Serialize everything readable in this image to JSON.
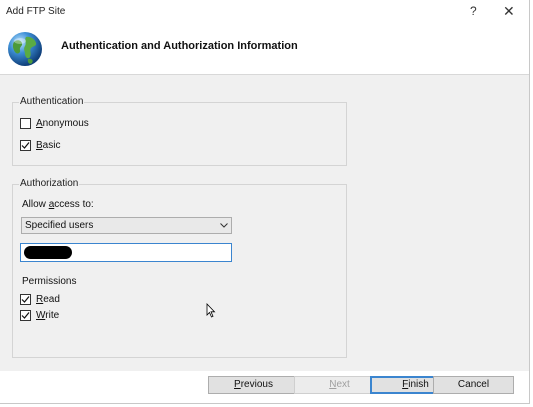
{
  "window": {
    "title": "Add FTP Site",
    "help_glyph": "?",
    "close_glyph": "✕"
  },
  "header": {
    "title": "Authentication and Authorization Information",
    "icon": "globe-icon"
  },
  "authentication": {
    "legend": "Authentication",
    "options": [
      {
        "label_mnemonic": "A",
        "label_rest": "nonymous",
        "checked": false
      },
      {
        "label_mnemonic": "B",
        "label_rest": "asic",
        "checked": true
      }
    ]
  },
  "authorization": {
    "legend": "Authorization",
    "allow_access_prefix": "Allow ",
    "allow_access_mnemonic": "a",
    "allow_access_suffix": "ccess to:",
    "selected_option": "Specified users",
    "users_value_redacted": true,
    "permissions_label": "Permissions",
    "permissions": [
      {
        "label_mnemonic": "R",
        "label_rest": "ead",
        "checked": true
      },
      {
        "label_mnemonic": "W",
        "label_rest": "rite",
        "checked": true
      }
    ]
  },
  "buttons": {
    "previous_mnemonic": "P",
    "previous_rest": "revious",
    "next_mnemonic": "N",
    "next_rest": "ext",
    "finish_mnemonic": "F",
    "finish_rest": "inish",
    "cancel": "Cancel"
  }
}
